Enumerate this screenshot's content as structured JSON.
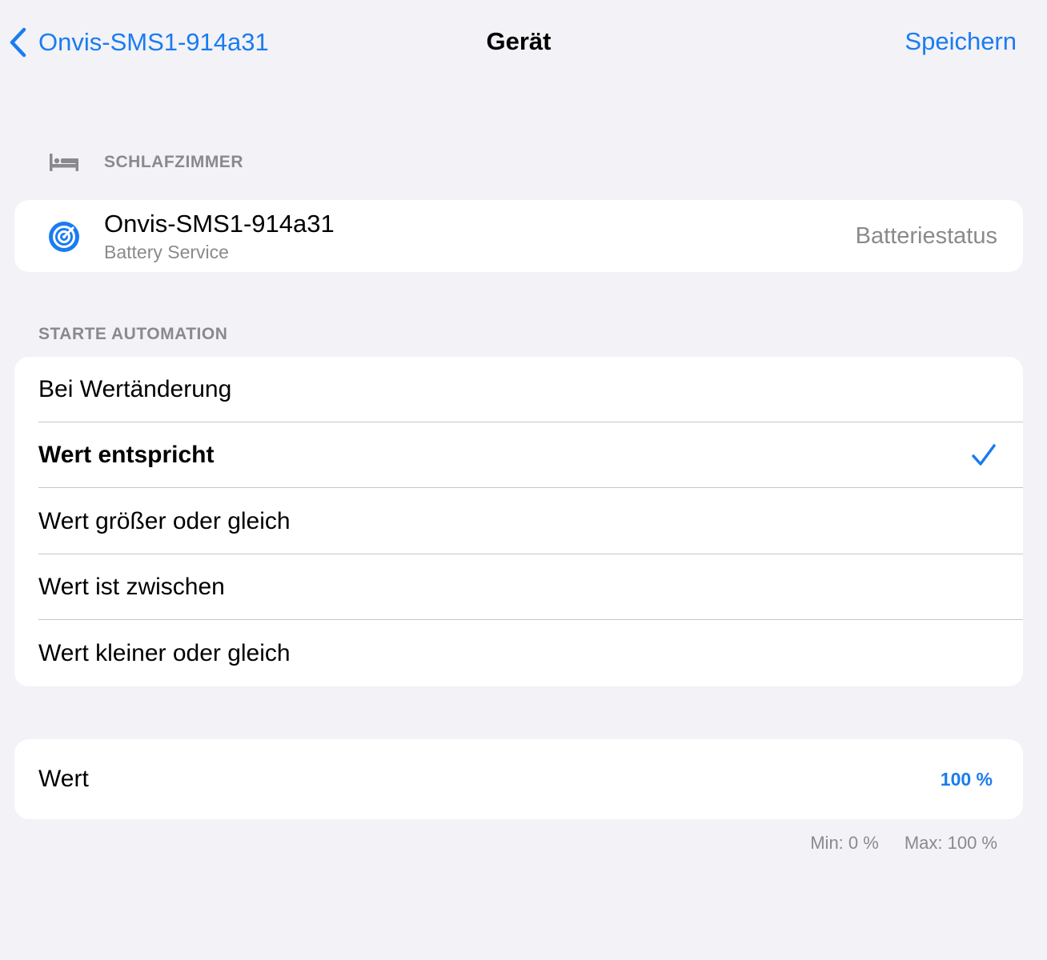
{
  "nav": {
    "back_label": "Onvis-SMS1-914a31",
    "title": "Gerät",
    "save_label": "Speichern"
  },
  "room": {
    "icon": "bed-icon",
    "label": "SCHLAFZIMMER"
  },
  "device": {
    "icon": "radar-target-icon",
    "name": "Onvis-SMS1-914a31",
    "service": "Battery Service",
    "characteristic": "Batteriestatus"
  },
  "automation": {
    "section_label": "STARTE AUTOMATION",
    "selected_index": 1,
    "options": [
      {
        "label": "Bei Wertänderung"
      },
      {
        "label": "Wert entspricht"
      },
      {
        "label": "Wert größer oder gleich"
      },
      {
        "label": "Wert ist zwischen"
      },
      {
        "label": "Wert kleiner oder gleich"
      }
    ]
  },
  "value": {
    "label": "Wert",
    "current": "100 %",
    "min_label": "Min: 0 %",
    "max_label": "Max: 100 %"
  },
  "colors": {
    "accent": "#1a7cf0",
    "background": "#f2f2f7",
    "secondary_text": "#8a8a8e"
  }
}
